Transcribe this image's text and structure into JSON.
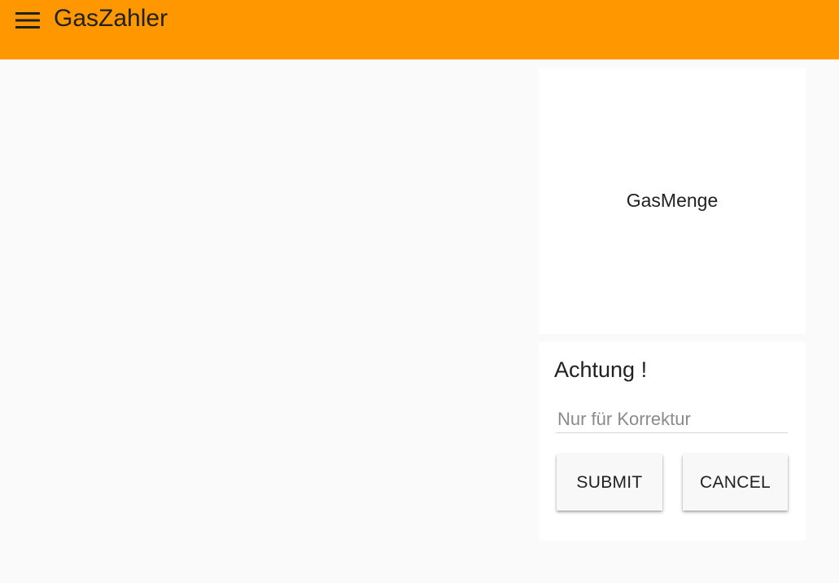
{
  "app": {
    "title": "GasZahler",
    "accent_color": "#ff9800",
    "menu_icon": "hamburger-menu-icon"
  },
  "gas_card": {
    "label": "GasMenge"
  },
  "correction_card": {
    "title": "Achtung !",
    "input": {
      "value": "",
      "placeholder": "Nur für Korrektur"
    },
    "submit_label": "SUBMIT",
    "cancel_label": "CANCEL"
  }
}
